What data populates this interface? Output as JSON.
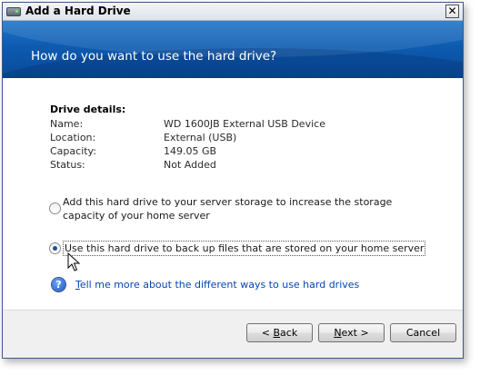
{
  "window": {
    "title": "Add a Hard Drive",
    "close_glyph": "✕"
  },
  "banner": {
    "heading": "How do you want to use the hard drive?"
  },
  "drive_details": {
    "heading": "Drive details:",
    "rows": [
      {
        "label": "Name:",
        "value": "WD 1600JB External USB Device"
      },
      {
        "label": "Location:",
        "value": "External (USB)"
      },
      {
        "label": "Capacity:",
        "value": "149.05 GB"
      },
      {
        "label": "Status:",
        "value": "Not Added"
      }
    ]
  },
  "options": [
    {
      "text": "Add this hard drive to your server storage to increase the storage capacity of your home server",
      "selected": false
    },
    {
      "text": "Use this hard drive to back up files that are stored on your home server",
      "selected": true
    }
  ],
  "help": {
    "icon": "help-icon",
    "link_first_letter": "T",
    "link_rest": "ell me more about the different ways to use hard drives"
  },
  "buttons": {
    "back": {
      "prefix": "< ",
      "mnemonic": "B",
      "rest": "ack"
    },
    "next": {
      "mnemonic": "N",
      "rest": "ext >"
    },
    "cancel": {
      "label": "Cancel"
    }
  },
  "colors": {
    "banner_blue": "#0d5bb0",
    "link_blue": "#0645b5"
  }
}
